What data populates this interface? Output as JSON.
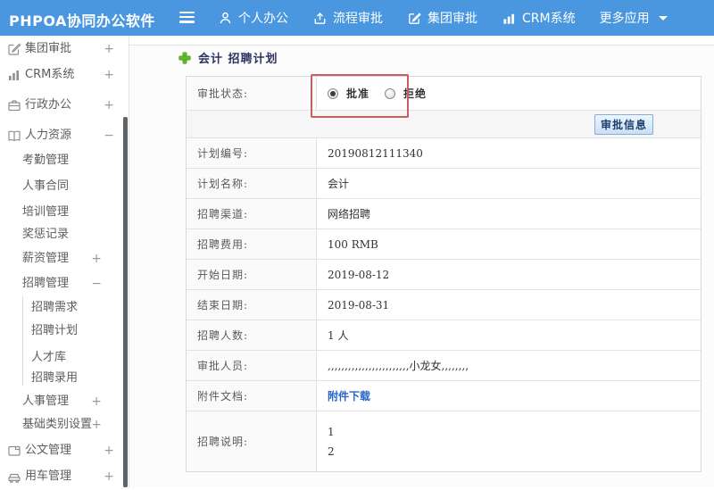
{
  "topbar": {
    "logo": "PHPOA协同办公软件",
    "nav": [
      {
        "label": "个人办公",
        "icon": "user-icon"
      },
      {
        "label": "流程审批",
        "icon": "flow-icon"
      },
      {
        "label": "集团审批",
        "icon": "edit-icon"
      },
      {
        "label": "CRM系统",
        "icon": "chart-icon"
      },
      {
        "label": "更多应用",
        "icon": "caret-down-icon"
      }
    ]
  },
  "sidebar": {
    "items": [
      {
        "label": "集团审批",
        "icon": "edit-icon",
        "toggle": "+"
      },
      {
        "label": "CRM系统",
        "icon": "chart-icon",
        "toggle": "+"
      },
      {
        "label": "行政办公",
        "icon": "briefcase-icon",
        "toggle": "+"
      },
      {
        "label": "人力资源",
        "icon": "book-icon",
        "toggle": "−"
      },
      {
        "label": "考勤管理"
      },
      {
        "label": "人事合同"
      },
      {
        "label": "培训管理"
      },
      {
        "label": "奖惩记录"
      },
      {
        "label": "薪资管理",
        "toggle": "+"
      },
      {
        "label": "招聘管理",
        "toggle": "−"
      },
      {
        "label": "招聘需求"
      },
      {
        "label": "招聘计划"
      },
      {
        "label": "人才库"
      },
      {
        "label": "招聘录用"
      },
      {
        "label": "人事管理",
        "toggle": "+"
      },
      {
        "label": "基础类别设置",
        "toggle": "+"
      },
      {
        "label": "公文管理",
        "icon": "doc-icon",
        "toggle": "+"
      },
      {
        "label": "用车管理",
        "icon": "car-icon",
        "toggle": "+"
      }
    ]
  },
  "main": {
    "title": "会计 招聘计划",
    "approval": {
      "status_label": "审批状态:",
      "options": [
        {
          "label": "批准",
          "selected": true
        },
        {
          "label": "拒绝",
          "selected": false
        }
      ],
      "button_label": "审批信息"
    },
    "fields": [
      {
        "label": "计划编号:",
        "value": "20190812111340"
      },
      {
        "label": "计划名称:",
        "value": "会计"
      },
      {
        "label": "招聘渠道:",
        "value": "网络招聘"
      },
      {
        "label": "招聘费用:",
        "value": "100 RMB"
      },
      {
        "label": "开始日期:",
        "value": "2019-08-12"
      },
      {
        "label": "结束日期:",
        "value": "2019-08-31"
      },
      {
        "label": "招聘人数:",
        "value": "1 人"
      },
      {
        "label": "审批人员:",
        "value": ",,,,,,,,,,,,,,,,,,,,,,,,小龙女,,,,,,,,"
      },
      {
        "label": "附件文档:",
        "value": "附件下载"
      },
      {
        "label": "招聘说明:",
        "value": "1\n2"
      }
    ],
    "colors": {
      "topbar_blue": "#4a97e0",
      "annotation_red": "#c4615c",
      "link_blue": "#2866c8",
      "plus_green": "#67b826",
      "title_navy": "#2e3263"
    }
  }
}
